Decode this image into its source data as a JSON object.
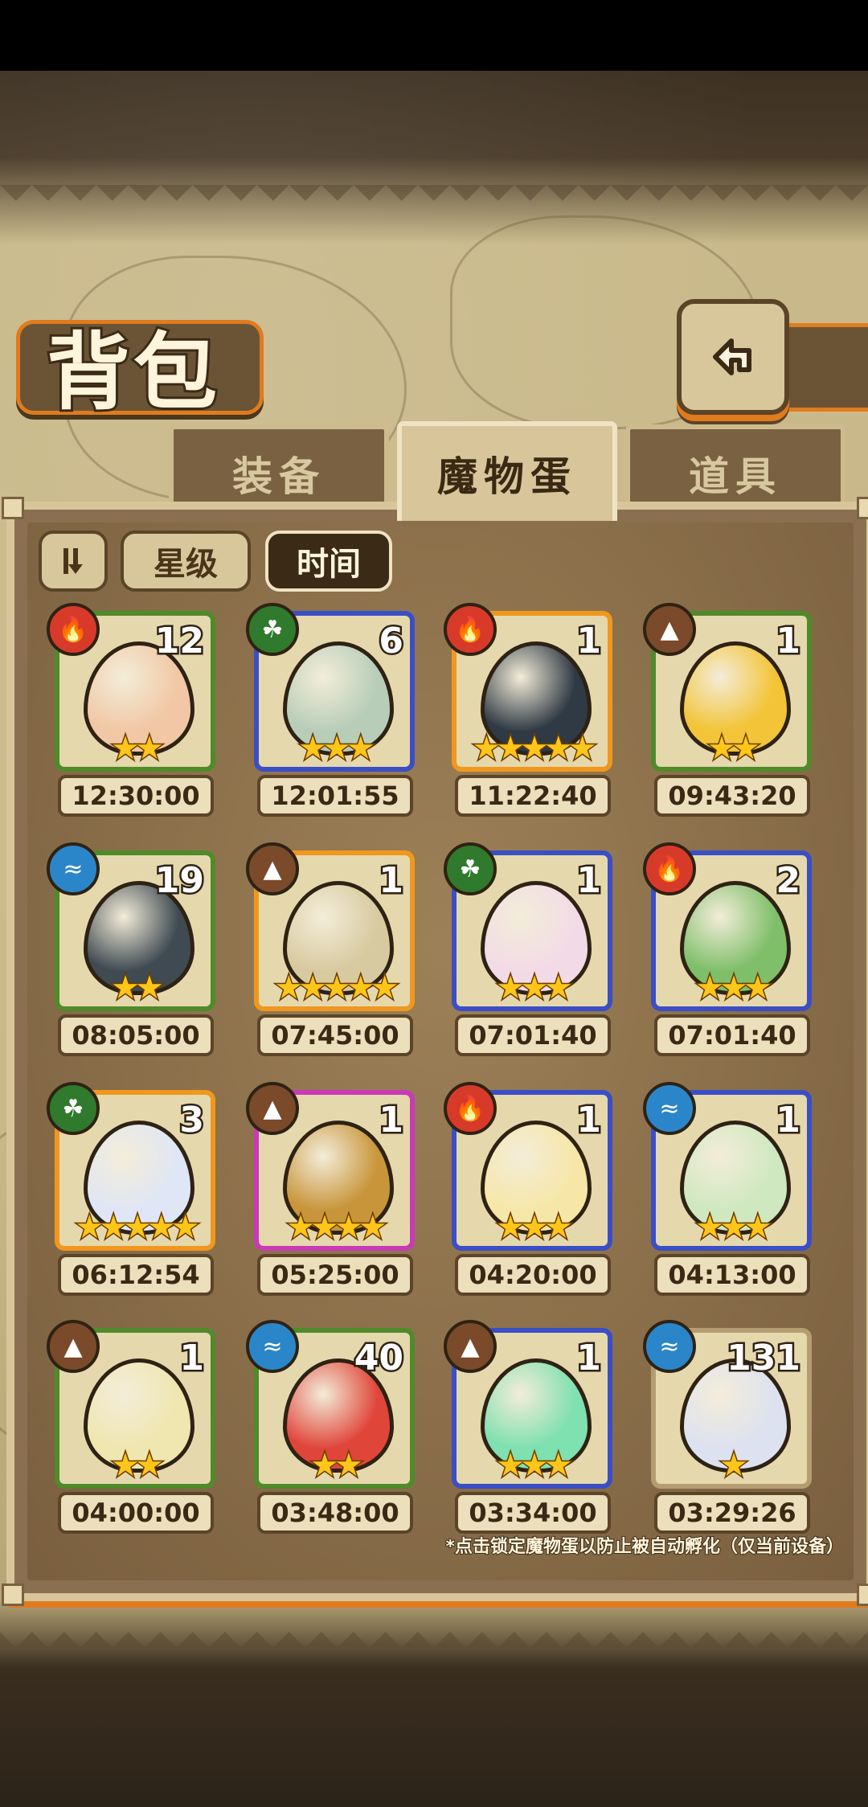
{
  "header": {
    "title": "背包"
  },
  "tabs": [
    {
      "label": "装备"
    },
    {
      "label": "魔物蛋"
    },
    {
      "label": "道具"
    }
  ],
  "active_tab": "魔物蛋",
  "sort": {
    "star_label": "星级",
    "time_label": "时间",
    "active": "时间"
  },
  "colors": {
    "fire": "#d83a2a",
    "grass": "#2f7a2c",
    "water": "#2a86c8",
    "earth": "#7a4a2a",
    "frame_green": "#4f8b2a",
    "frame_blue": "#3a4fc6",
    "frame_orange": "#f0981e",
    "frame_pink": "#c83ab8",
    "frame_tan": "#b59d72"
  },
  "eggs": [
    {
      "element": "fire",
      "count": "12",
      "stars": 2,
      "timer": "12:30:00",
      "frame": "green",
      "egg_color": "#f1c7a5"
    },
    {
      "element": "grass",
      "count": "6",
      "stars": 3,
      "timer": "12:01:55",
      "frame": "blue",
      "egg_color": "#b7cdb8"
    },
    {
      "element": "fire",
      "count": "1",
      "stars": 5,
      "timer": "11:22:40",
      "frame": "orange",
      "egg_color": "#2f3a44"
    },
    {
      "element": "earth",
      "count": "1",
      "stars": 2,
      "timer": "09:43:20",
      "frame": "green",
      "egg_color": "#f3c437"
    },
    {
      "element": "water",
      "count": "19",
      "stars": 2,
      "timer": "08:05:00",
      "frame": "green",
      "egg_color": "#3f4a52"
    },
    {
      "element": "earth",
      "count": "1",
      "stars": 5,
      "timer": "07:45:00",
      "frame": "orange",
      "egg_color": "#d8caa0"
    },
    {
      "element": "grass",
      "count": "1",
      "stars": 3,
      "timer": "07:01:40",
      "frame": "blue",
      "egg_color": "#f2dbe6"
    },
    {
      "element": "fire",
      "count": "2",
      "stars": 3,
      "timer": "07:01:40",
      "frame": "blue",
      "egg_color": "#7fbf6a"
    },
    {
      "element": "grass",
      "count": "3",
      "stars": 5,
      "timer": "06:12:54",
      "frame": "orange",
      "egg_color": "#dfe6f5"
    },
    {
      "element": "earth",
      "count": "1",
      "stars": 4,
      "timer": "05:25:00",
      "frame": "pink",
      "egg_color": "#c8953a"
    },
    {
      "element": "fire",
      "count": "1",
      "stars": 3,
      "timer": "04:20:00",
      "frame": "blue",
      "egg_color": "#f6e7a8"
    },
    {
      "element": "water",
      "count": "1",
      "stars": 3,
      "timer": "04:13:00",
      "frame": "blue",
      "egg_color": "#cfe8c0"
    },
    {
      "element": "earth",
      "count": "1",
      "stars": 2,
      "timer": "04:00:00",
      "frame": "green",
      "egg_color": "#efe6b0"
    },
    {
      "element": "water",
      "count": "40",
      "stars": 2,
      "timer": "03:48:00",
      "frame": "green",
      "egg_color": "#e0453a"
    },
    {
      "element": "earth",
      "count": "1",
      "stars": 3,
      "timer": "03:34:00",
      "frame": "blue",
      "egg_color": "#7fe0b0"
    },
    {
      "element": "water",
      "count": "131",
      "stars": 1,
      "timer": "03:29:26",
      "frame": "tan",
      "egg_color": "#dde2f0"
    }
  ],
  "footnote": "*点击锁定魔物蛋以防止被自动孵化（仅当前设备）"
}
